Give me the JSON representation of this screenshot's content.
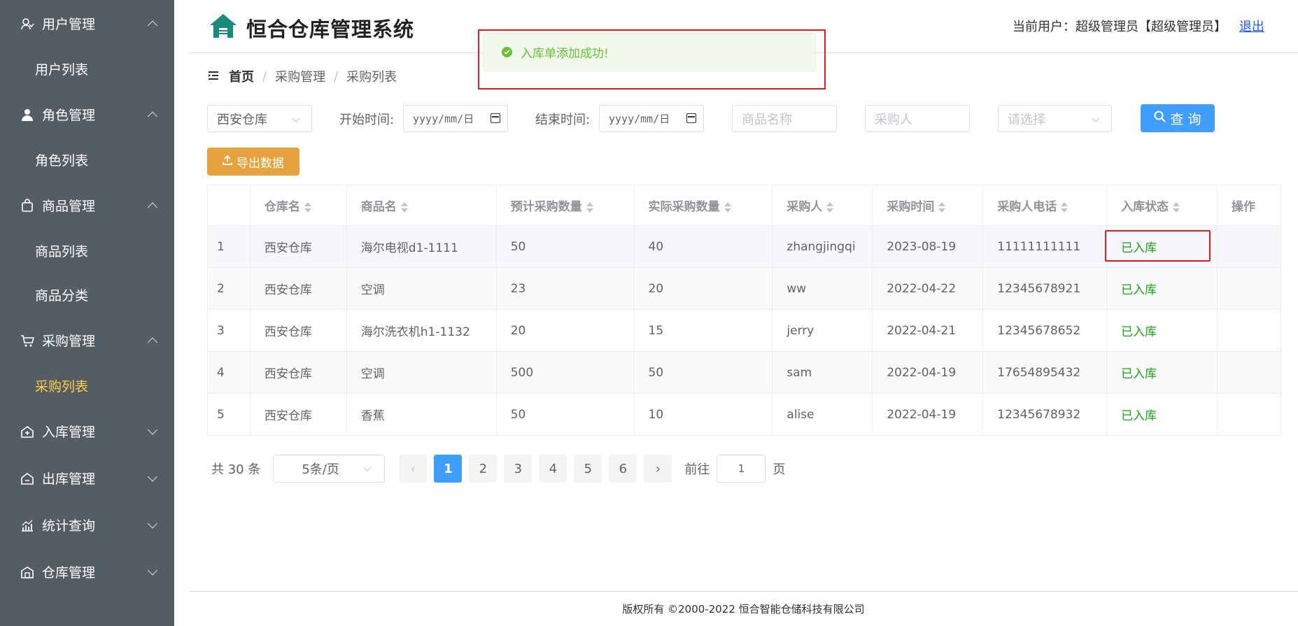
{
  "sidebar": {
    "groups": [
      {
        "label": "用户管理",
        "icon": "user-icon",
        "expanded": true,
        "items": [
          "用户列表"
        ]
      },
      {
        "label": "角色管理",
        "icon": "person-icon",
        "expanded": true,
        "items": [
          "角色列表"
        ]
      },
      {
        "label": "商品管理",
        "icon": "bag-icon",
        "expanded": true,
        "items": [
          "商品列表",
          "商品分类"
        ]
      },
      {
        "label": "采购管理",
        "icon": "cart-icon",
        "expanded": true,
        "items": [
          "采购列表"
        ]
      },
      {
        "label": "入库管理",
        "icon": "inbound-icon",
        "expanded": false,
        "items": []
      },
      {
        "label": "出库管理",
        "icon": "outbound-icon",
        "expanded": false,
        "items": []
      },
      {
        "label": "统计查询",
        "icon": "chart-icon",
        "expanded": false,
        "items": []
      },
      {
        "label": "仓库管理",
        "icon": "warehouse-icon",
        "expanded": false,
        "items": []
      }
    ],
    "active_item": "采购列表"
  },
  "header": {
    "title": "恒合仓库管理系统",
    "current_user_text": "当前用户：超级管理员【超级管理员】",
    "logout": "退出"
  },
  "toast": {
    "message": "入库单添加成功!"
  },
  "breadcrumb": {
    "home": "首页",
    "level1": "采购管理",
    "level2": "采购列表"
  },
  "filters": {
    "warehouse": "西安仓库",
    "start_label": "开始时间:",
    "start_placeholder": "yyyy/mm/日",
    "end_label": "结束时间:",
    "end_placeholder": "yyyy/mm/日",
    "product_placeholder": "商品名称",
    "buyer_placeholder": "采购人",
    "status_placeholder": "请选择",
    "query_button": "查 询",
    "export_button": "导出数据"
  },
  "table": {
    "headers": [
      "仓库名",
      "商品名",
      "预计采购数量",
      "实际采购数量",
      "采购人",
      "采购时间",
      "采购人电话",
      "入库状态",
      "操作"
    ],
    "rows": [
      [
        "1",
        "西安仓库",
        "海尔电视d1-1111",
        "50",
        "40",
        "zhangjingqi",
        "2023-08-19",
        "11111111111",
        "已入库"
      ],
      [
        "2",
        "西安仓库",
        "空调",
        "23",
        "20",
        "ww",
        "2022-04-22",
        "12345678921",
        "已入库"
      ],
      [
        "3",
        "西安仓库",
        "海尔洗衣机h1-1132",
        "20",
        "15",
        "jerry",
        "2022-04-21",
        "12345678652",
        "已入库"
      ],
      [
        "4",
        "西安仓库",
        "空调",
        "500",
        "50",
        "sam",
        "2022-04-19",
        "17654895432",
        "已入库"
      ],
      [
        "5",
        "西安仓库",
        "香蕉",
        "50",
        "10",
        "alise",
        "2022-04-19",
        "12345678932",
        "已入库"
      ]
    ]
  },
  "pagination": {
    "total": "共 30 条",
    "page_size": "5条/页",
    "pages": [
      "1",
      "2",
      "3",
      "4",
      "5",
      "6"
    ],
    "current": "1",
    "goto_label": "前往",
    "goto_value": "1",
    "page_suffix": "页"
  },
  "footer": {
    "copyright": "版权所有 ©2000-2022  恒合智能仓储科技有限公司"
  },
  "colors": {
    "sidebar_bg": "#545c64",
    "active": "#ffd04b",
    "primary": "#409eff",
    "warning": "#e6a23c",
    "success": "#67c23a",
    "status_green": "#1aa21a",
    "highlight_frame": "#e21b1b"
  }
}
